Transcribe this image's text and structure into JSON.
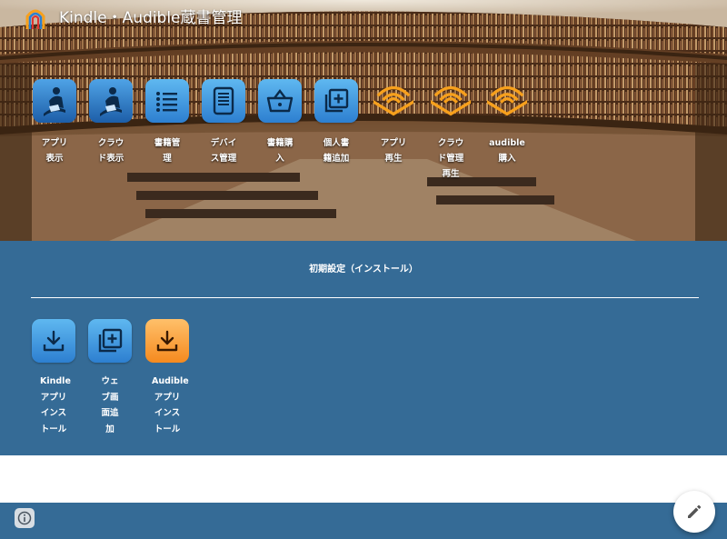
{
  "header": {
    "title": "Kindle・Audible蔵書管理",
    "logo_icon": "kindle-audible-logo"
  },
  "apps": [
    {
      "label": "アプリ表示",
      "icon": "kindle-reader-icon"
    },
    {
      "label": "クラウド表示",
      "icon": "kindle-reader-icon"
    },
    {
      "label": "書籍管理",
      "icon": "list-icon"
    },
    {
      "label": "デバイス管理",
      "icon": "ereader-device-icon"
    },
    {
      "label": "書籍購入",
      "icon": "shopping-basket-icon"
    },
    {
      "label": "個人書籍追加",
      "icon": "add-library-icon"
    },
    {
      "label": "アプリ再生",
      "icon": "audible-icon"
    },
    {
      "label": "クラウド管理再生",
      "icon": "audible-icon"
    },
    {
      "label": "audible購入",
      "icon": "audible-icon"
    }
  ],
  "install": {
    "title": "初期設定（インストール）",
    "items": [
      {
        "label": "Kindleアプリインストール",
        "icon": "download-icon",
        "color": "#2d7fd0"
      },
      {
        "label": "ウェブ画面追加",
        "icon": "add-library-icon",
        "color": "#2d7fd0"
      },
      {
        "label": "Audibleアプリインストール",
        "icon": "download-icon",
        "color": "#f58a1f"
      }
    ]
  },
  "colors": {
    "section_bg": "#356b96",
    "accent_blue": "#2d7fd0",
    "accent_orange": "#f58a1f",
    "audible_orange": "#f7a01c"
  },
  "footer": {
    "info_icon": "info-icon",
    "edit_icon": "pencil-icon"
  }
}
